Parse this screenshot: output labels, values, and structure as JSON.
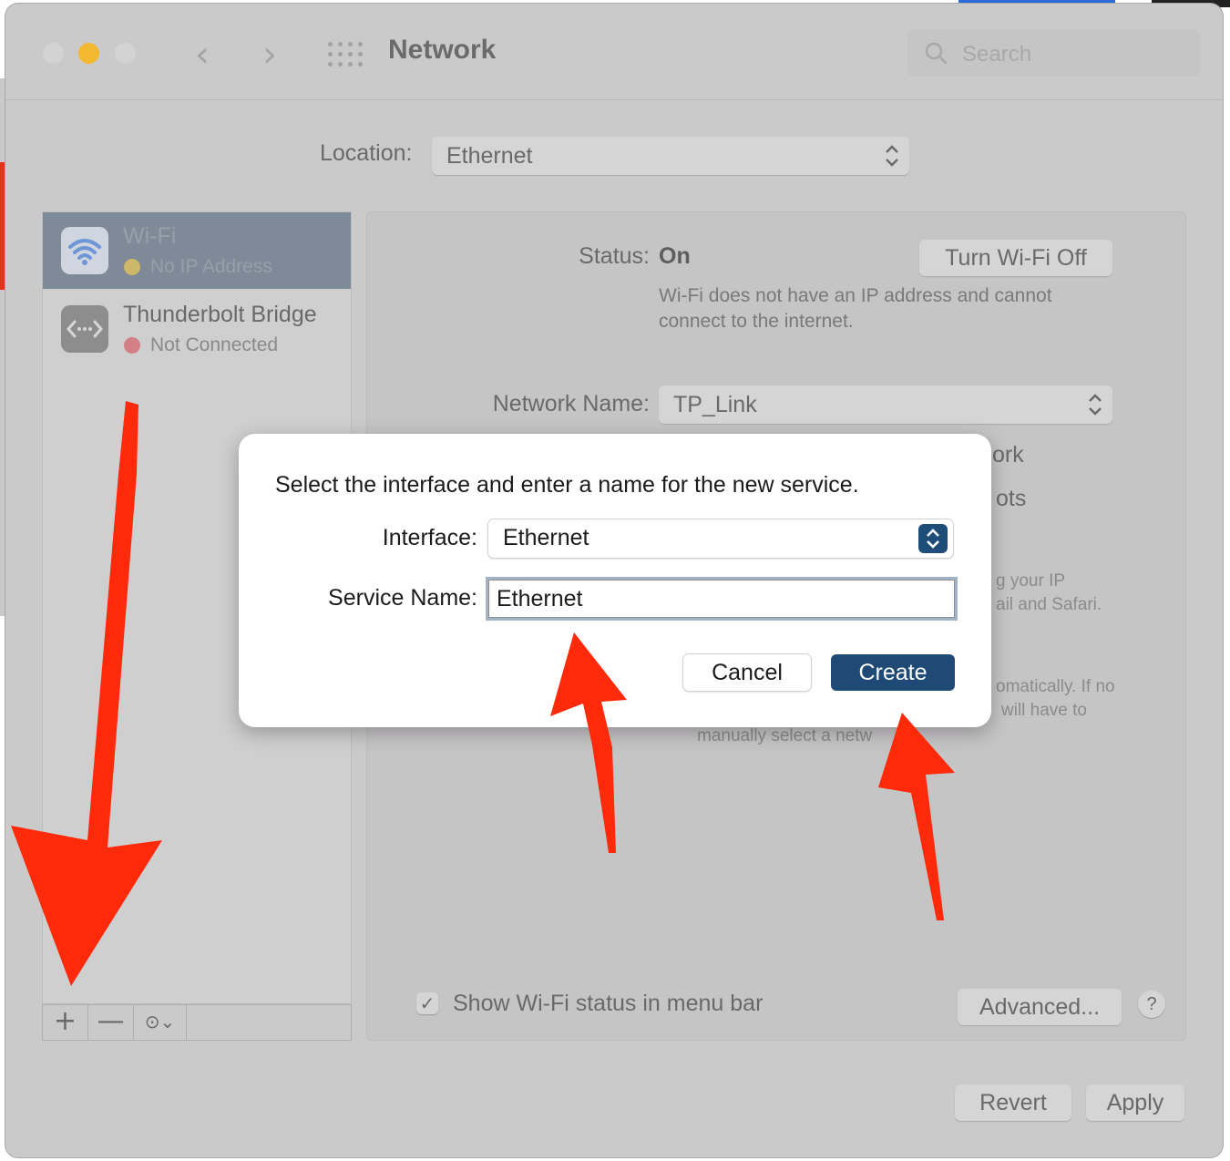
{
  "window": {
    "title": "Network",
    "search_placeholder": "Search"
  },
  "location": {
    "label": "Location:",
    "value": "Ethernet"
  },
  "sidebar": {
    "services": [
      {
        "name": "Wi-Fi",
        "status": "No IP Address",
        "status_color": "#cdb86a",
        "icon": "wifi-icon",
        "selected": true
      },
      {
        "name": "Thunderbolt Bridge",
        "status": "Not Connected",
        "status_color": "#d27f86",
        "icon": "thunderbolt-bridge-icon",
        "selected": false
      }
    ],
    "toolbar": {
      "add": "+",
      "remove": "—",
      "action": "⊙⌄"
    }
  },
  "panel": {
    "status_label": "Status:",
    "status_value": "On",
    "turn_off_button": "Turn Wi-Fi Off",
    "status_desc_line1": "Wi-Fi does not have an IP address and cannot",
    "status_desc_line2": "connect to the internet.",
    "network_name_label": "Network Name:",
    "network_name_value": "TP_Link",
    "partial_1": "ork",
    "partial_2": "ots",
    "partial_3": "g your IP",
    "partial_4": "ail and Safari.",
    "partial_5": "omatically. If no",
    "partial_6": "will have to",
    "partial_7": "manually select a netw",
    "show_status_checkbox": "Show Wi-Fi status in menu bar",
    "show_status_checked": true,
    "advanced_button": "Advanced...",
    "help_button": "?"
  },
  "footer": {
    "revert_button": "Revert",
    "apply_button": "Apply"
  },
  "dialog": {
    "message": "Select the interface and enter a name for the new service.",
    "interface_label": "Interface:",
    "interface_value": "Ethernet",
    "service_name_label": "Service Name:",
    "service_name_value": "Ethernet",
    "cancel_button": "Cancel",
    "create_button": "Create"
  },
  "colors": {
    "accent": "#1e4a75",
    "annotation_red": "#ff2a0a",
    "traffic_yellow": "#f2b82f"
  }
}
